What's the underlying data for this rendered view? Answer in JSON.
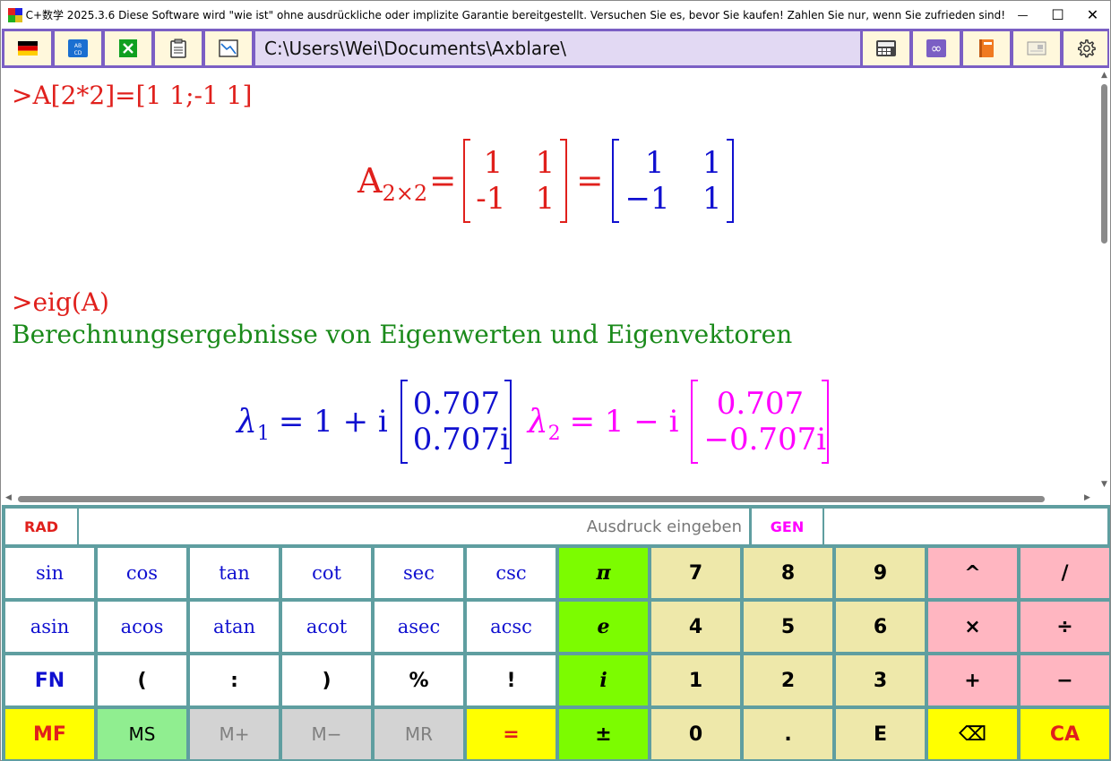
{
  "window": {
    "title": "C+数学 2025.3.6 Diese Software wird \"wie ist\" ohne ausdrückliche oder implizite Garantie bereitgestellt. Versuchen Sie es, bevor Sie kaufen! Zahlen Sie nur, wenn Sie zufrieden sind!",
    "minimize": "—",
    "maximize": "☐",
    "close": "✕"
  },
  "toolbar": {
    "path": "C:\\Users\\Wei\\Documents\\Axblare\\",
    "left_icons": [
      "german-flag-icon",
      "abcd-keyboard-icon",
      "excel-icon",
      "clipboard-icon",
      "chart-icon"
    ],
    "right_icons": [
      "calculator-icon",
      "infinity-icon",
      "book-icon",
      "card-icon",
      "gear-icon"
    ],
    "abcd_label": "AB CD",
    "infinity_label": "∞"
  },
  "output": {
    "cmd1": ">A[2*2]=[1 1;-1 1]",
    "matrix_name": "A",
    "matrix_dims": "2×2",
    "eq": "=",
    "matrix_input": [
      [
        "1",
        "1"
      ],
      [
        "-1",
        "1"
      ]
    ],
    "matrix_result": [
      [
        "1",
        "1"
      ],
      [
        "−1",
        "1"
      ]
    ],
    "cmd2": ">eig(A)",
    "info": "Berechnungsergebnisse von Eigenwerten und Eigenvektoren",
    "lambda1": {
      "symbol": "λ",
      "sub": "1",
      "value": "= 1 + i",
      "vector": [
        "0.707",
        "0.707i"
      ]
    },
    "lambda2": {
      "symbol": "λ",
      "sub": "2",
      "value": "= 1 − i",
      "vector": [
        "0.707",
        "−0.707i"
      ]
    }
  },
  "calc": {
    "rad": "RAD",
    "placeholder": "Ausdruck eingeben",
    "gen": "GEN",
    "rows": [
      [
        "sin",
        "cos",
        "tan",
        "cot",
        "sec",
        "csc",
        "π",
        "7",
        "8",
        "9",
        "^",
        "/"
      ],
      [
        "asin",
        "acos",
        "atan",
        "acot",
        "asec",
        "acsc",
        "e",
        "4",
        "5",
        "6",
        "×",
        "÷"
      ],
      [
        "FN",
        "(",
        ":",
        ")",
        "%",
        "!",
        "i",
        "1",
        "2",
        "3",
        "+",
        "−"
      ],
      [
        "MF",
        "MS",
        "M+",
        "M−",
        "MR",
        "=",
        "±",
        "0",
        ".",
        "E",
        "⌫",
        "CA"
      ]
    ]
  },
  "colors": {
    "toolbar": "#7b5fc4",
    "command": "#e0201c",
    "info": "#1a8a1a",
    "lambda1": "#1010d0",
    "lambda2": "#ff00ff",
    "calc_border": "#5f9ea0"
  }
}
